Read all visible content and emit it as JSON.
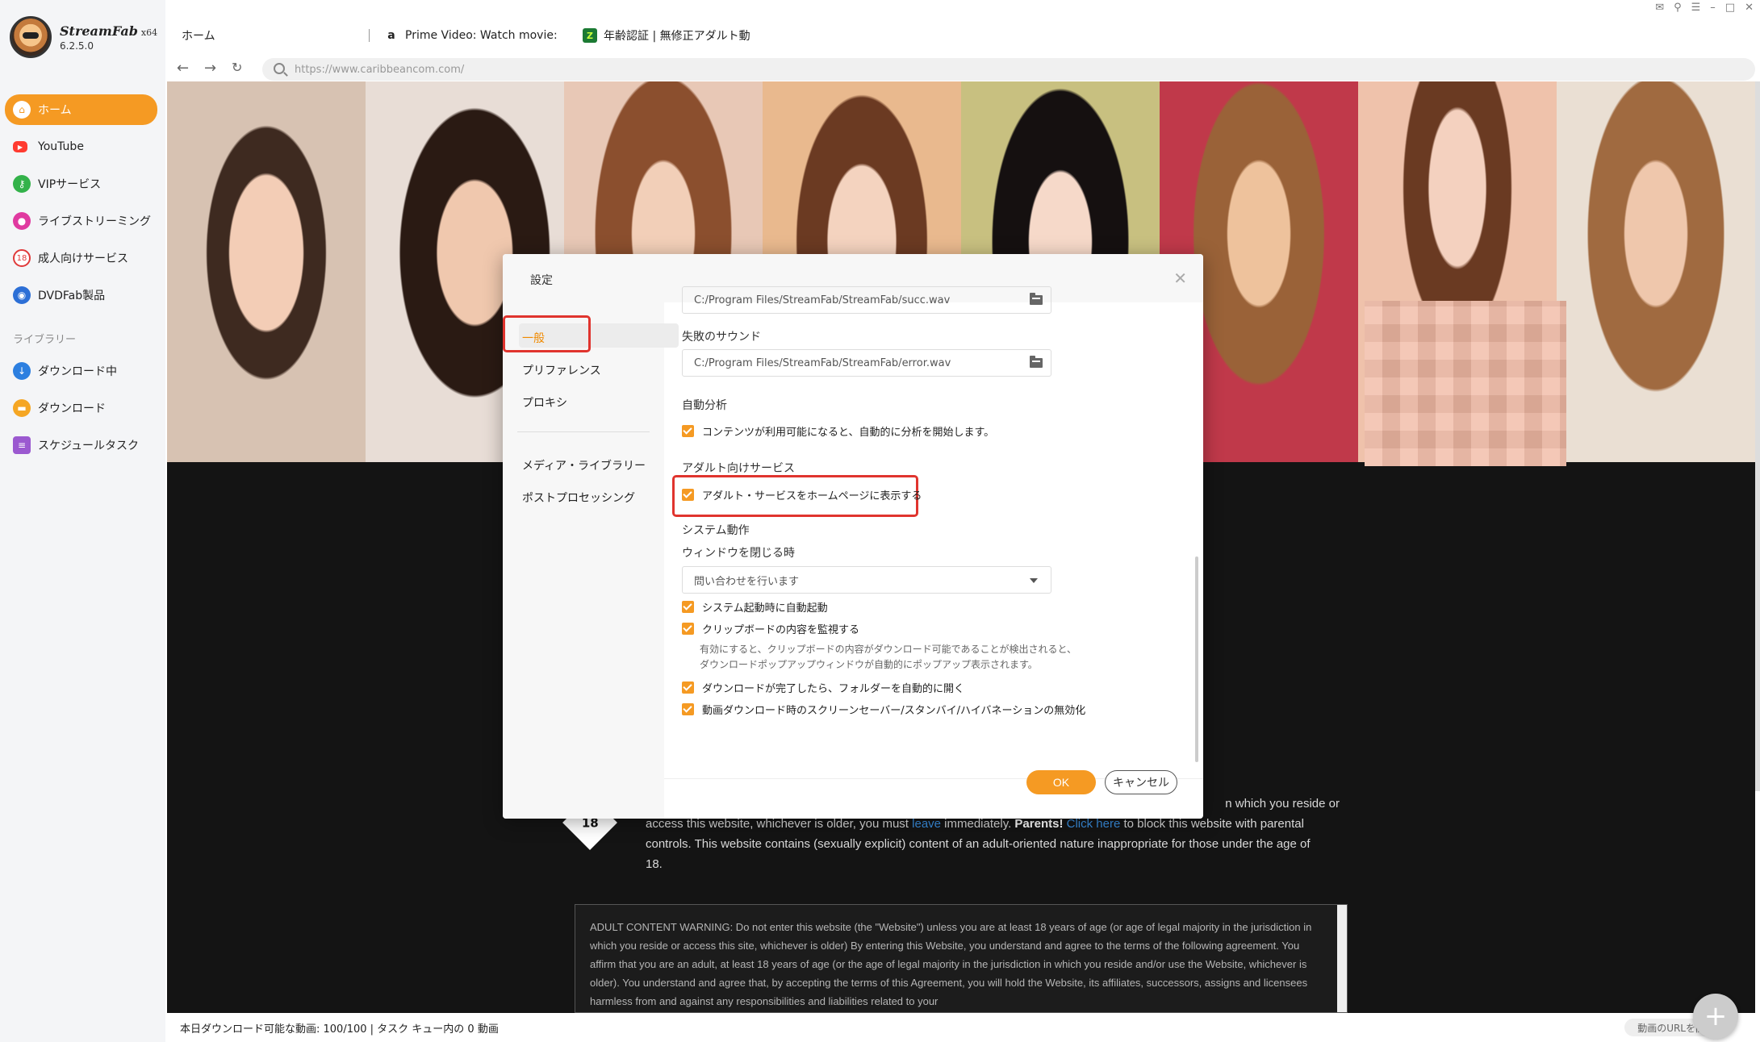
{
  "app": {
    "name": "StreamFab",
    "arch": "x64",
    "version": "6.2.5.0"
  },
  "sidebar": {
    "items": [
      {
        "label": "ホーム",
        "icon": "home-icon",
        "color": "#ffffff"
      },
      {
        "label": "YouTube",
        "icon": "youtube-icon",
        "color": "#ff3b30"
      },
      {
        "label": "VIPサービス",
        "icon": "key-icon",
        "color": "#33b24a"
      },
      {
        "label": "ライブストリーミング",
        "icon": "camera-icon",
        "color": "#e03aa0"
      },
      {
        "label": "成人向けサービス",
        "icon": "adult-icon",
        "color": "#e03a3a"
      },
      {
        "label": "DVDFab製品",
        "icon": "dvdfab-icon",
        "color": "#2c6fd6"
      }
    ],
    "library_label": "ライブラリー",
    "library": [
      {
        "label": "ダウンロード中",
        "icon": "download-icon",
        "color": "#2c7fe0"
      },
      {
        "label": "ダウンロード",
        "icon": "folder-icon",
        "color": "#f5a623"
      },
      {
        "label": "スケジュールタスク",
        "icon": "schedule-icon",
        "color": "#9b59d0"
      }
    ]
  },
  "tabs": [
    {
      "label": "ホーム"
    },
    {
      "label": "Prime Video: Watch movie:",
      "icon": "amazon-icon"
    },
    {
      "label": "年齢認証 | 無修正アダルト動",
      "icon": "caribbeancom-icon"
    }
  ],
  "address": {
    "url": "https://www.caribbeancom.com/"
  },
  "web": {
    "line1_end": "n which you reside or",
    "line2_a": "access this website, whichever is older, you must ",
    "line2_leave": "leave",
    "line2_b": " immediately. ",
    "line2_parents": "Parents!",
    "line2_click": "Click here",
    "line2_c": " to block this website with parental",
    "line3": "controls. This website contains (sexually explicit) content of an adult-oriented nature inappropriate for those under the age of",
    "line4": "18.",
    "badge": "18",
    "warning": "ADULT CONTENT WARNING: Do not enter this website (the \"Website\") unless you are at least 18 years of age (or age of legal majority in the jurisdiction in which you reside or access this site, whichever is older) By entering this Website, you understand and agree to the terms of the following agreement. You affirm that you are an adult, at least 18 years of age (or the age of legal majority in the jurisdiction in which you reside and/or use the Website, whichever is older). You understand and agree that, by accepting the terms of this Agreement, you will hold the Website, its affiliates, successors, assigns and licensees harmless from and against any responsibilities and liabilities related to your"
  },
  "status": {
    "text": "本日ダウンロード可能な動画: 100/100 | タスク キュー内の 0 動画",
    "open_url": "動画のURLを開く"
  },
  "settings": {
    "title": "設定",
    "nav": [
      "一般",
      "プリファレンス",
      "プロキシ",
      "メディア・ライブラリー",
      "ポストプロセッシング"
    ],
    "top_path": "C:/Program Files/StreamFab/StreamFab/succ.wav",
    "fail_sound_label": "失敗のサウンド",
    "fail_sound_path": "C:/Program Files/StreamFab/StreamFab/error.wav",
    "auto_analysis_label": "自動分析",
    "auto_analysis_check": "コンテンツが利用可能になると、自動的に分析を開始します。",
    "adult_label": "アダルト向けサービス",
    "adult_check": "アダルト・サービスをホームページに表示する",
    "system_label": "システム動作",
    "close_label": "ウィンドウを閉じる時",
    "close_select": "問い合わせを行います",
    "startup_check": "システム起動時に自動起動",
    "clipboard_check": "クリップボードの内容を監視する",
    "clipboard_note1": "有効にすると、クリップボードの内容がダウンロード可能であることが検出されると、",
    "clipboard_note2": "ダウンロードポップアップウィンドウが自動的にポップアップ表示されます。",
    "open_folder_check": "ダウンロードが完了したら、フォルダーを自動的に開く",
    "screensaver_check": "動画ダウンロード時のスクリーンセーバー/スタンバイ/ハイバネーションの無効化",
    "ok": "OK",
    "cancel": "キャンセル"
  }
}
